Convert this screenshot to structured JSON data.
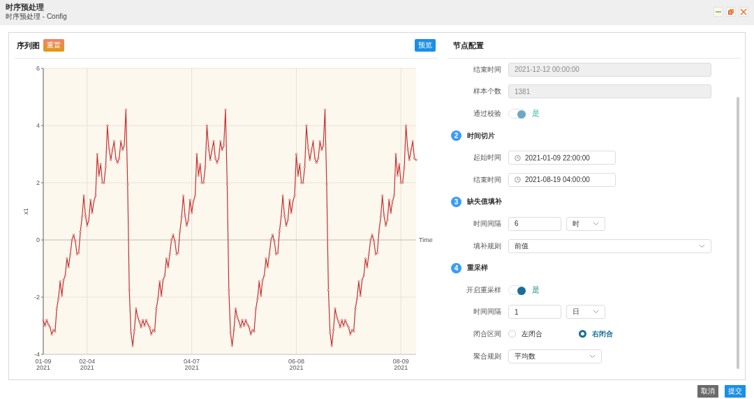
{
  "window": {
    "title": "时序预处理",
    "subtitle": "时序预处理 - Config"
  },
  "chart_panel": {
    "title": "序列图",
    "reset_button": "重置",
    "preview_button": "预览",
    "chart_data": {
      "type": "line",
      "xlabel": "Time",
      "ylabel": "x1",
      "grid": true,
      "ylim": [
        -4,
        6
      ],
      "categories": [
        "01-09\n2021",
        null,
        null,
        null,
        null,
        null,
        null,
        null,
        null,
        null,
        null,
        null,
        null,
        null,
        null,
        null,
        null,
        null,
        null,
        null,
        null,
        null,
        null,
        null,
        null,
        null,
        "02-04\n2021",
        null,
        null,
        null,
        null,
        null,
        null,
        null,
        null,
        null,
        null,
        null,
        null,
        null,
        null,
        null,
        null,
        null,
        null,
        null,
        null,
        null,
        null,
        null,
        null,
        null,
        null,
        null,
        null,
        null,
        null,
        null,
        null,
        null,
        null,
        null,
        null,
        null,
        null,
        null,
        null,
        null,
        null,
        null,
        null,
        null,
        null,
        null,
        null,
        null,
        null,
        null,
        null,
        null,
        null,
        null,
        null,
        null,
        null,
        null,
        null,
        null,
        "04-07\n2021",
        null,
        null,
        null,
        null,
        null,
        null,
        null,
        null,
        null,
        null,
        null,
        null,
        null,
        null,
        null,
        null,
        null,
        null,
        null,
        null,
        null,
        null,
        null,
        null,
        null,
        null,
        null,
        null,
        null,
        null,
        null,
        null,
        null,
        null,
        null,
        null,
        null,
        null,
        null,
        null,
        null,
        null,
        null,
        null,
        null,
        null,
        null,
        null,
        null,
        null,
        null,
        null,
        null,
        null,
        null,
        null,
        null,
        null,
        null,
        null,
        null,
        "06-08\n2021",
        null,
        null,
        null,
        null,
        null,
        null,
        null,
        null,
        null,
        null,
        null,
        null,
        null,
        null,
        null,
        null,
        null,
        null,
        null,
        null,
        null,
        null,
        null,
        null,
        null,
        null,
        null,
        null,
        null,
        null,
        null,
        null,
        null,
        null,
        null,
        null,
        null,
        null,
        null,
        null,
        null,
        null,
        null,
        null,
        null,
        null,
        null,
        null,
        null,
        null,
        null,
        null,
        null,
        null,
        null,
        null,
        null,
        null,
        null,
        null,
        null,
        "08-09\n2021",
        null,
        null,
        null,
        null,
        null,
        null,
        null,
        null,
        null
      ],
      "yticks": [
        -4,
        -2,
        0,
        2,
        4,
        6
      ],
      "series": [
        {
          "color": "#c62f2f",
          "marker": "circle",
          "values": [
            -2.8,
            -3.0,
            -2.8,
            -2.95,
            -3.05,
            -3.3,
            -3.15,
            -3.2,
            -2.4,
            -2.05,
            -1.45,
            -1.95,
            -1.4,
            -1.25,
            -0.65,
            -0.95,
            -0.5,
            0.0,
            0.18,
            -0.05,
            -0.5,
            -0.45,
            0.3,
            0.8,
            1.55,
            0.85,
            0.5,
            0.7,
            1.4,
            0.95,
            1.35,
            1.55,
            3.0,
            2.25,
            2.65,
            2.0,
            2.0,
            2.55,
            4.0,
            3.2,
            2.8,
            3.15,
            3.45,
            2.85,
            2.7,
            2.85,
            3.45,
            3.15,
            3.3,
            4.55,
            1.95,
            -1.75,
            -3.25,
            -3.7,
            -3.15,
            -2.4,
            -2.7,
            -2.85,
            -3.05,
            -2.8,
            -3.0,
            -2.8,
            -2.95,
            -3.05,
            -3.3,
            -3.15,
            -3.2,
            -2.4,
            -2.05,
            -1.45,
            -1.95,
            -1.4,
            -1.25,
            -0.65,
            -0.95,
            -0.5,
            0.0,
            0.18,
            -0.05,
            -0.5,
            -0.45,
            0.3,
            0.8,
            1.55,
            0.85,
            0.5,
            0.7,
            1.4,
            0.95,
            1.35,
            1.55,
            3.0,
            2.25,
            2.65,
            2.0,
            2.0,
            2.55,
            4.0,
            3.2,
            2.8,
            3.15,
            3.45,
            2.85,
            2.7,
            2.85,
            3.45,
            3.15,
            3.3,
            4.55,
            1.95,
            -1.75,
            -3.25,
            -3.7,
            -3.15,
            -2.4,
            -2.7,
            -2.85,
            -3.05,
            -2.8,
            -3.0,
            -2.8,
            -2.95,
            -3.05,
            -3.3,
            -3.15,
            -3.2,
            -2.4,
            -2.05,
            -1.45,
            -1.95,
            -1.4,
            -1.25,
            -0.65,
            -0.95,
            -0.5,
            0.0,
            0.18,
            -0.05,
            -0.5,
            -0.45,
            0.3,
            0.8,
            1.55,
            0.85,
            0.5,
            0.7,
            1.4,
            0.95,
            1.35,
            1.55,
            3.0,
            2.25,
            2.65,
            2.0,
            2.0,
            2.55,
            4.0,
            3.2,
            2.8,
            3.15,
            3.45,
            2.85,
            2.7,
            2.85,
            3.45,
            3.15,
            3.3,
            4.55,
            1.95,
            -1.75,
            -3.25,
            -3.7,
            -3.15,
            -2.4,
            -2.7,
            -2.85,
            -3.05,
            -2.8,
            -3.0,
            -2.8,
            -2.95,
            -3.05,
            -3.3,
            -3.15,
            -3.2,
            -2.4,
            -2.05,
            -1.45,
            -1.95,
            -1.4,
            -1.25,
            -0.65,
            -0.95,
            -0.5,
            0.0,
            0.18,
            -0.05,
            -0.5,
            -0.45,
            0.3,
            0.8,
            1.55,
            0.85,
            0.5,
            0.7,
            1.4,
            0.95,
            1.35,
            1.55,
            3.0,
            2.25,
            2.65,
            2.0,
            2.0,
            2.55,
            4.0,
            3.2,
            2.8,
            3.15,
            3.45,
            2.85,
            2.8
          ]
        }
      ]
    }
  },
  "config_panel": {
    "title": "节点配置",
    "fields": [
      {
        "kind": "text",
        "label": "结束时间",
        "value": "2021-12-12 00:00:00",
        "disabled": true
      },
      {
        "kind": "text",
        "label": "样本个数",
        "value": "1381",
        "disabled": true
      },
      {
        "kind": "toggle",
        "label": "通过校验",
        "on": true,
        "text": "是",
        "disabled": true
      }
    ],
    "steps": [
      {
        "number": "2",
        "title": "时间切片",
        "fields": [
          {
            "kind": "datetime",
            "label": "起始时间",
            "value": "2021-01-09 22:00:00"
          },
          {
            "kind": "datetime",
            "label": "结束时间",
            "value": "2021-08-19 04:00:00"
          }
        ]
      },
      {
        "number": "3",
        "title": "缺失值填补",
        "fields": [
          {
            "kind": "number_unit",
            "label": "时间间隔",
            "value": "6",
            "unit": "时"
          },
          {
            "kind": "select",
            "label": "填补规则",
            "value": "前值"
          }
        ]
      },
      {
        "number": "4",
        "title": "重采样",
        "fields": [
          {
            "kind": "toggle",
            "label": "开启重采样",
            "on": true,
            "text": "是",
            "disabled": false
          },
          {
            "kind": "number_unit",
            "label": "时间间隔",
            "value": "1",
            "unit": "日"
          },
          {
            "kind": "radio",
            "label": "闭合区间",
            "options": [
              {
                "label": "左闭合",
                "selected": false
              },
              {
                "label": "右闭合",
                "selected": true
              }
            ]
          },
          {
            "kind": "compact_select",
            "label": "聚合规则",
            "value": "平均数"
          }
        ]
      }
    ]
  },
  "footer_buttons": [
    {
      "label": "取消",
      "kind": "secondary"
    },
    {
      "label": "提交",
      "kind": "primary"
    }
  ]
}
